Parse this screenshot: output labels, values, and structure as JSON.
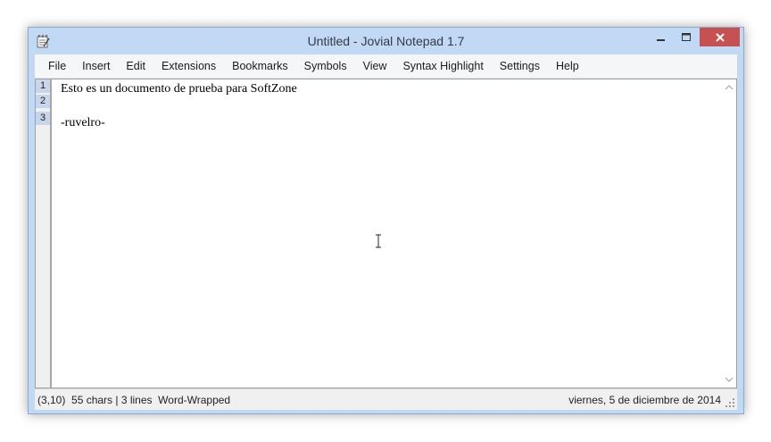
{
  "window": {
    "title": "Untitled - Jovial Notepad 1.7",
    "icon": "notepad-icon"
  },
  "controls": {
    "minimize": "minimize-icon",
    "maximize": "maximize-icon",
    "close": "close-icon",
    "close_color": "#c75050"
  },
  "menubar": {
    "items": [
      "File",
      "Insert",
      "Edit",
      "Extensions",
      "Bookmarks",
      "Symbols",
      "View",
      "Syntax Highlight",
      "Settings",
      "Help"
    ]
  },
  "editor": {
    "line_numbers": [
      "1",
      "2",
      "3"
    ],
    "lines": [
      "Esto es un documento de prueba para SoftZone",
      "",
      "-ruvelro-"
    ]
  },
  "statusbar": {
    "left": "(3,10)  55 chars | 3 lines  Word-Wrapped",
    "right": "viernes, 5 de diciembre de 2014"
  }
}
